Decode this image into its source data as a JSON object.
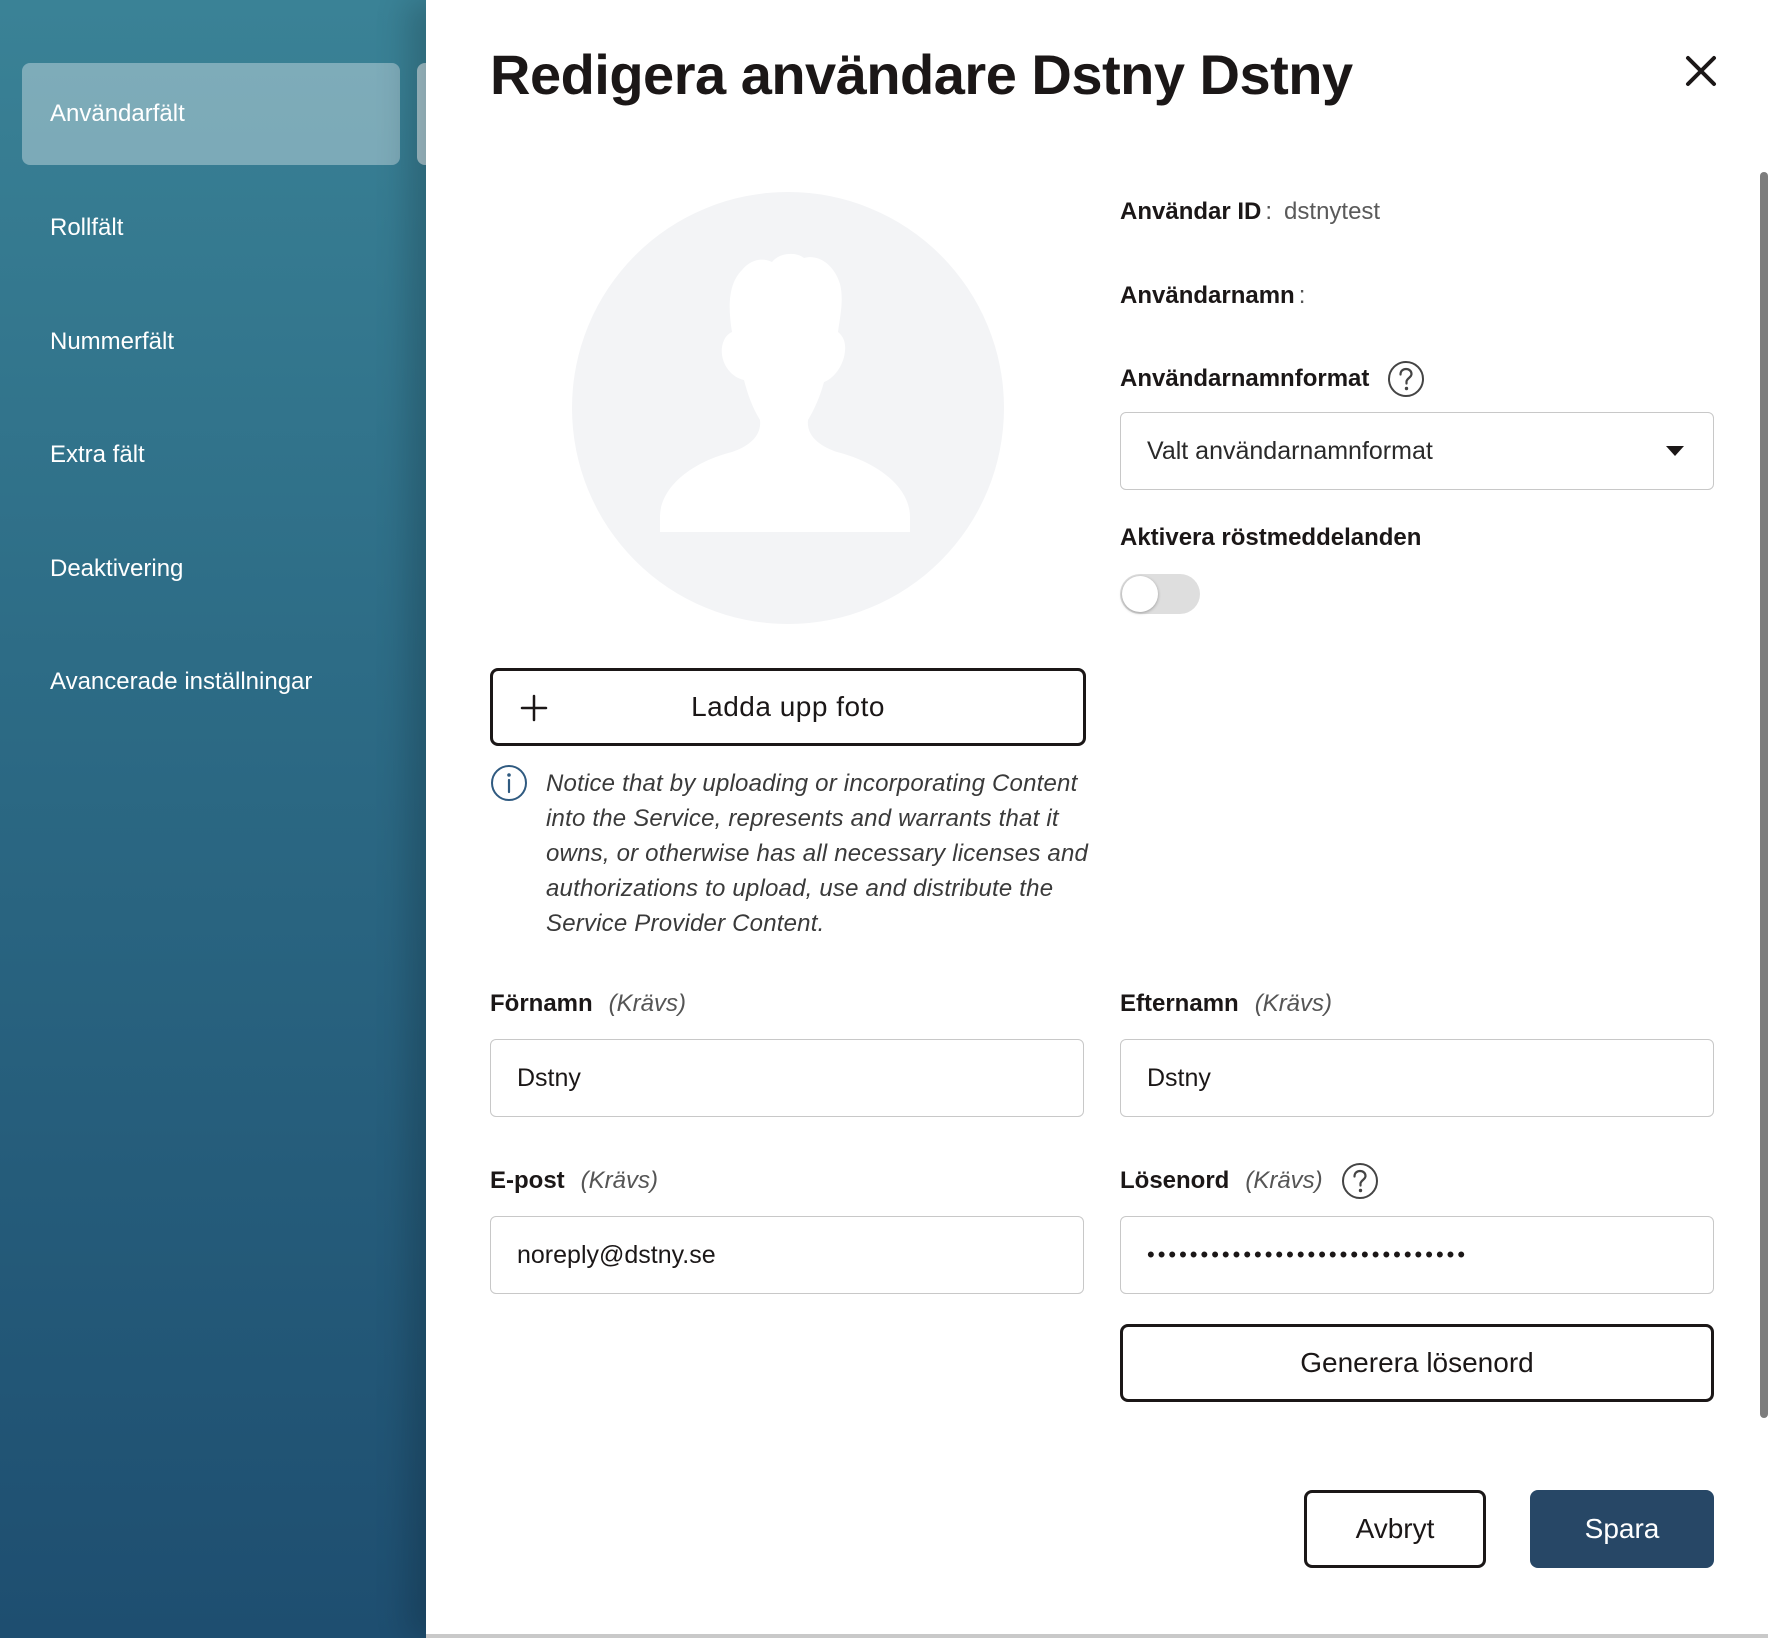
{
  "sidebar": {
    "items": [
      {
        "label": "Användarfält",
        "active": true
      },
      {
        "label": "Rollfält"
      },
      {
        "label": "Nummerfält"
      },
      {
        "label": "Extra fält"
      },
      {
        "label": "Deaktivering"
      },
      {
        "label": "Avancerade inställningar"
      }
    ]
  },
  "dialog": {
    "title": "Redigera användare Dstny Dstny",
    "upload_label": "Ladda upp foto",
    "notice": "Notice that by uploading or incorporating Content into the Service, represents and warrants that it owns, or otherwise has all necessary licenses and authorizations to upload, use and distribute the Service Provider Content.",
    "user_id_label": "Användar ID",
    "user_id_value": "dstnytest",
    "username_label": "Användarnamn",
    "username_value": "",
    "colon": ":",
    "username_format_label": "Användarnamnformat",
    "username_format_value": "Valt användarnamnformat",
    "voicemail_label": "Aktivera röstmeddelanden",
    "voicemail_enabled": false,
    "required_text": "(Krävs)",
    "first_name_label": "Förnamn",
    "first_name_value": "Dstny",
    "last_name_label": "Efternamn",
    "last_name_value": "Dstny",
    "email_label": "E-post",
    "email_value": "noreply@dstny.se",
    "password_label": "Lösenord",
    "password_value": "••••••••••••••••••••••••••••••",
    "generate_password_label": "Generera lösenord",
    "cancel_label": "Avbryt",
    "save_label": "Spara"
  },
  "colors": {
    "sidebar_top": "#3a8296",
    "sidebar_bottom": "#1e4e70",
    "primary_button": "#274766",
    "text": "#1b1717"
  },
  "icons": [
    "close-icon",
    "plus-icon",
    "info-icon",
    "help-icon",
    "chevron-down-icon",
    "avatar-placeholder-icon"
  ]
}
